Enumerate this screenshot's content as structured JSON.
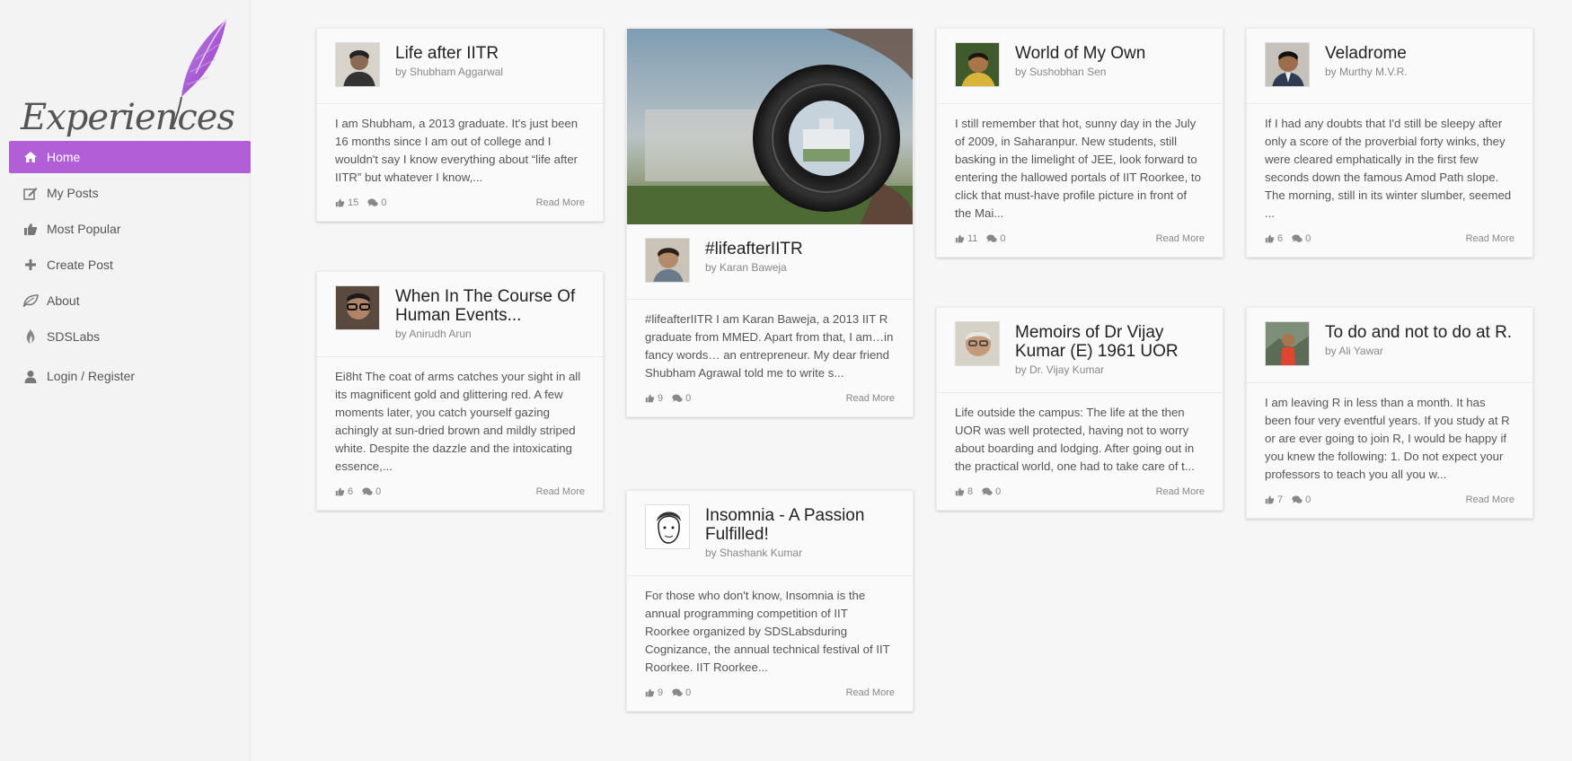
{
  "brand": {
    "logo_text": "Experiences",
    "accent": "#b15fd6"
  },
  "nav": [
    {
      "label": "Home",
      "icon": "home-icon",
      "active": true
    },
    {
      "label": "My Posts",
      "icon": "edit-icon"
    },
    {
      "label": "Most Popular",
      "icon": "thumbs-up-icon"
    },
    {
      "label": "Create Post",
      "icon": "plus-icon"
    },
    {
      "label": "About",
      "icon": "leaf-icon"
    },
    {
      "label": "SDSLabs",
      "icon": "flame-icon"
    },
    {
      "label": "Login / Register",
      "icon": "user-icon"
    }
  ],
  "read_more": "Read More",
  "posts": [
    {
      "title": "Life after IITR",
      "author": "by Shubham Aggarwal",
      "excerpt": " I am Shubham, a 2013 graduate. It's just been 16 months since I am out of college and I wouldn't say I know everything about “life after IITR” but whatever I know,...",
      "likes": "15",
      "comments": "0"
    },
    {
      "title": "When In The Course Of Human Events...",
      "author": "by Anirudh Arun",
      "excerpt": "Ei8ht  The coat of arms catches your sight in all its magnificent gold and glittering red. A few moments later, you catch yourself gazing achingly at sun-dried brown and mildly striped white. Despite the dazzle and the intoxicating essence,...",
      "likes": "6",
      "comments": "0"
    },
    {
      "title": "#lifeafterIITR",
      "author": "by Karan Baweja",
      "excerpt": "#lifeafterIITR I am Karan Baweja, a 2013 IIT R graduate from MMED. Apart from that, I am…in fancy words… an entrepreneur. My dear friend Shubham Agrawal told me to write s...",
      "likes": "9",
      "comments": "0"
    },
    {
      "title": "Insomnia - A Passion Fulfilled!",
      "author": "by Shashank Kumar",
      "excerpt": "For those who don't know, Insomnia is the annual programming competition of IIT Roorkee organized by SDSLabsduring Cognizance, the annual technical festival of IIT Roorkee.   IIT Roorkee...",
      "likes": "9",
      "comments": "0"
    },
    {
      "title": "World of My Own",
      "author": "by Sushobhan Sen",
      "excerpt": "I still remember that hot, sunny day in the July of 2009, in Saharanpur. New students, still basking in the limelight of JEE, look forward to entering the hallowed portals of IIT Roorkee, to click that must-have profile picture in front of the Mai...",
      "likes": "11",
      "comments": "0"
    },
    {
      "title": "Memoirs of Dr Vijay Kumar (E) 1961 UOR",
      "author": "by Dr. Vijay Kumar",
      "excerpt": "Life outside the campus: The life at the then UOR was well protected, having not to worry about boarding and lodging. After going  out in the practical world, one had to take care of t...",
      "likes": "8",
      "comments": "0"
    },
    {
      "title": "Veladrome",
      "author": "by Murthy M.V.R.",
      "excerpt": "If I had any doubts that I'd still be sleepy after only a score of the proverbial forty winks, they were cleared emphatically in the first few seconds down the famous Amod Path slope. The morning, still in its winter slumber, seemed ...",
      "likes": "6",
      "comments": "0"
    },
    {
      "title": "To do and not to do at R.",
      "author": "by Ali Yawar",
      "excerpt": "I am leaving R in less than a month. It has been four very eventful years. If you study at R or are ever going to join R, I would be happy if you knew the following: 1. Do not expect your professors to teach you all you w...",
      "likes": "7",
      "comments": "0"
    }
  ]
}
